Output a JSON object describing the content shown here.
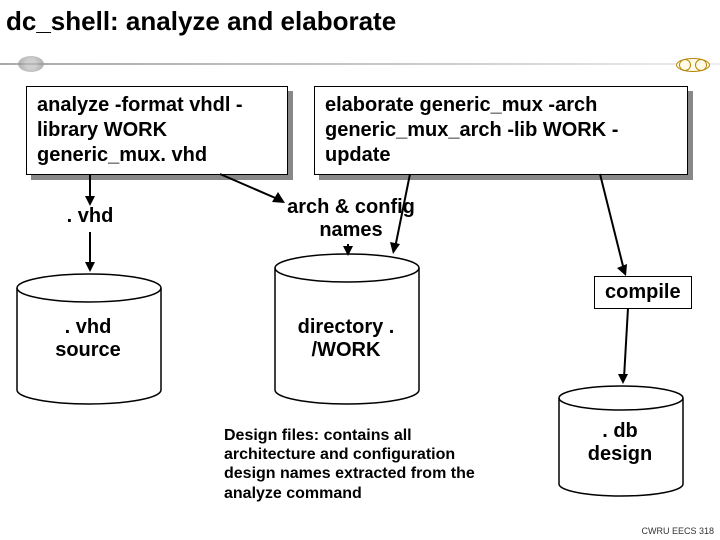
{
  "title": "dc_shell: analyze and elaborate",
  "boxes": {
    "analyze": "analyze -format vhdl -library WORK generic_mux. vhd",
    "elaborate": "elaborate generic_mux -arch generic_mux_arch -lib WORK -update",
    "compile": "compile"
  },
  "labels": {
    "vhd": ". vhd",
    "arch_config": "arch & config names",
    "vhd_source": ". vhd source",
    "work_dir": "directory . /WORK",
    "db_design": ". db design"
  },
  "design_files_note": "Design files: contains all architecture and configuration design names extracted from the analyze command",
  "footer": "CWRU EECS 318"
}
